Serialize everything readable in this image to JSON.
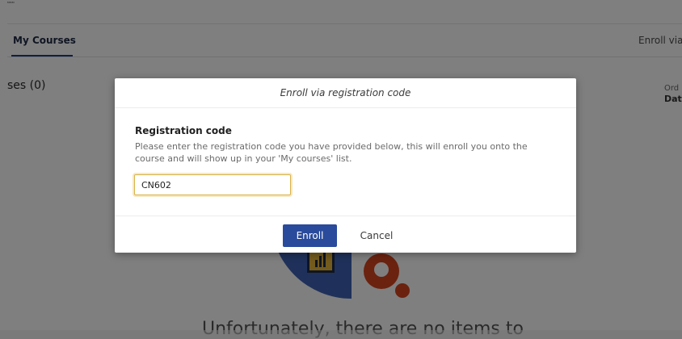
{
  "tabs": {
    "my_courses": "My Courses",
    "enroll_link": "Enroll via r"
  },
  "courses": {
    "heading_partial": "ses",
    "count": "(0)"
  },
  "sort": {
    "order_label": "Ord",
    "order_value": "Dat"
  },
  "empty_state": {
    "text": "Unfortunately, there are no items to"
  },
  "modal": {
    "title": "Enroll via registration code",
    "field_label": "Registration code",
    "help_text": "Please enter the registration code you have provided below, this will enroll you onto the course and will show up in your 'My courses' list.",
    "input_value": "CN602",
    "enroll_label": "Enroll",
    "cancel_label": "Cancel"
  },
  "colors": {
    "primary": "#2a4a9b",
    "focus_ring": "#d9b24a",
    "illustration_blue": "#3f63b5",
    "illustration_orange": "#d6451f"
  }
}
